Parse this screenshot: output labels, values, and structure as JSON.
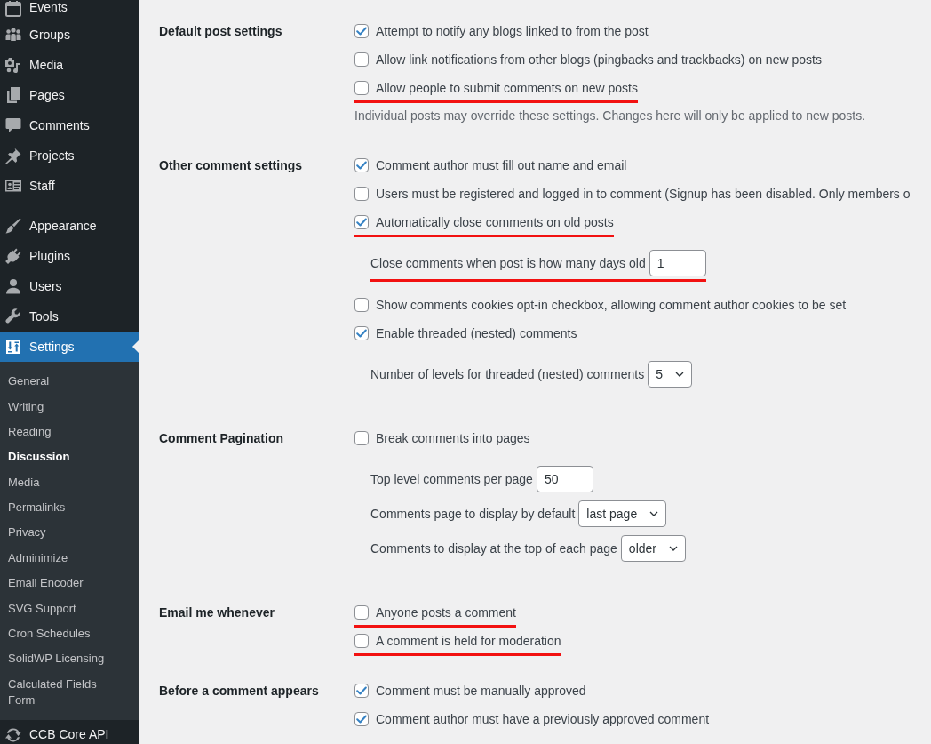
{
  "sidebar": {
    "menu_groups": [
      {
        "items": [
          {
            "label": "Events",
            "selected": false
          },
          {
            "label": "Groups",
            "selected": false
          },
          {
            "label": "Media",
            "selected": false
          },
          {
            "label": "Pages",
            "selected": false
          },
          {
            "label": "Comments",
            "selected": false
          },
          {
            "label": "Projects",
            "selected": false
          },
          {
            "label": "Staff",
            "selected": false
          }
        ]
      },
      {
        "items": [
          {
            "label": "Appearance",
            "selected": false
          },
          {
            "label": "Plugins",
            "selected": false
          },
          {
            "label": "Users",
            "selected": false
          },
          {
            "label": "Tools",
            "selected": false
          },
          {
            "label": "Settings",
            "selected": true,
            "submenu": [
              {
                "label": "General",
                "selected": false
              },
              {
                "label": "Writing",
                "selected": false
              },
              {
                "label": "Reading",
                "selected": false
              },
              {
                "label": "Discussion",
                "selected": true
              },
              {
                "label": "Media",
                "selected": false
              },
              {
                "label": "Permalinks",
                "selected": false
              },
              {
                "label": "Privacy",
                "selected": false
              },
              {
                "label": "Adminimize",
                "selected": false
              },
              {
                "label": "Email Encoder",
                "selected": false
              },
              {
                "label": "SVG Support",
                "selected": false
              },
              {
                "label": "Cron Schedules",
                "selected": false
              },
              {
                "label": "SolidWP Licensing",
                "selected": false
              },
              {
                "label": "Calculated Fields Form",
                "selected": false
              }
            ]
          },
          {
            "label": "CCB Core API",
            "selected": false
          }
        ]
      }
    ]
  },
  "settings": [
    {
      "title": "Default post settings",
      "rows": [
        {
          "kind": "checkbox",
          "label": "Attempt to notify any blogs linked to from the post",
          "checked": true,
          "underlined": false
        },
        {
          "kind": "checkbox",
          "label": "Allow link notifications from other blogs (pingbacks and trackbacks) on new posts",
          "checked": false,
          "underlined": false
        },
        {
          "kind": "checkbox",
          "label": "Allow people to submit comments on new posts",
          "checked": false,
          "underlined": true
        },
        {
          "kind": "description",
          "text": "Individual posts may override these settings. Changes here will only be applied to new posts.",
          "underlined": false
        }
      ]
    },
    {
      "title": "Other comment settings",
      "rows": [
        {
          "kind": "checkbox",
          "label": "Comment author must fill out name and email",
          "checked": true,
          "underlined": false
        },
        {
          "kind": "checkbox",
          "label": "Users must be registered and logged in to comment (Signup has been disabled. Only members o",
          "checked": false,
          "underlined": false
        },
        {
          "kind": "checkbox",
          "label": "Automatically close comments on old posts",
          "checked": true,
          "underlined": true
        },
        {
          "kind": "input",
          "label": "Close comments when post is how many days old",
          "value": "1",
          "underlined": true
        },
        {
          "kind": "checkbox",
          "label": "Show comments cookies opt-in checkbox, allowing comment author cookies to be set",
          "checked": false,
          "underlined": false
        },
        {
          "kind": "checkbox",
          "label": "Enable threaded (nested) comments",
          "checked": true,
          "underlined": false
        },
        {
          "kind": "select",
          "label": "Number of levels for threaded (nested) comments",
          "value": "5",
          "underlined": false
        }
      ]
    },
    {
      "title": "Comment Pagination",
      "rows": [
        {
          "kind": "checkbox",
          "label": "Break comments into pages",
          "checked": false,
          "underlined": false
        },
        {
          "kind": "input",
          "label": "Top level comments per page",
          "value": "50",
          "underlined": false
        },
        {
          "kind": "select",
          "label": "Comments page to display by default",
          "value": "last page",
          "underlined": false
        },
        {
          "kind": "select",
          "label": "Comments to display at the top of each page",
          "value": "older",
          "underlined": false
        }
      ]
    },
    {
      "title": "Email me whenever",
      "rows": [
        {
          "kind": "checkbox",
          "label": "Anyone posts a comment",
          "checked": false,
          "underlined": true
        },
        {
          "kind": "checkbox",
          "label": "A comment is held for moderation",
          "checked": false,
          "underlined": true
        }
      ]
    },
    {
      "title": "Before a comment appears",
      "rows": [
        {
          "kind": "checkbox",
          "label": "Comment must be manually approved",
          "checked": true,
          "underlined": false
        },
        {
          "kind": "checkbox",
          "label": "Comment author must have a previously approved comment",
          "checked": true,
          "underlined": false
        }
      ]
    }
  ]
}
